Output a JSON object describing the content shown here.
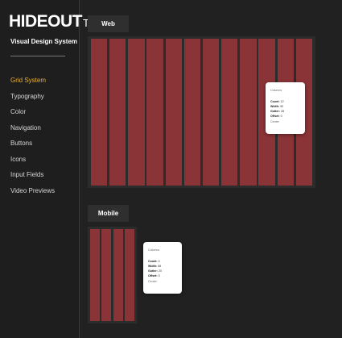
{
  "app": {
    "logo_main": "HIDEOUT",
    "logo_suffix": "TV",
    "subtitle": "Visual Design System"
  },
  "sidebar": {
    "items": [
      {
        "label": "Grid System",
        "active": true
      },
      {
        "label": "Typography",
        "active": false
      },
      {
        "label": "Color",
        "active": false
      },
      {
        "label": "Navigation",
        "active": false
      },
      {
        "label": "Buttons",
        "active": false
      },
      {
        "label": "Icons",
        "active": false
      },
      {
        "label": "Input Fields",
        "active": false
      },
      {
        "label": "Video Previews",
        "active": false
      }
    ]
  },
  "sections": {
    "web": {
      "label": "Web",
      "popup": {
        "title": "Columns",
        "count_label": "Count:",
        "count": "12",
        "width_label": "Width:",
        "width": "90",
        "gutter_label": "Gutter:",
        "gutter": "28",
        "offset_label": "Offset:",
        "offset": "0",
        "alignment": "Center"
      }
    },
    "mobile": {
      "label": "Mobile",
      "popup": {
        "title": "Columns",
        "count_label": "Count:",
        "count": "4",
        "width_label": "Width:",
        "width": "68",
        "gutter_label": "Gutter:",
        "gutter": "20",
        "offset_label": "Offset:",
        "offset": "0",
        "alignment": "Center"
      }
    }
  },
  "colors": {
    "background": "#212121",
    "column": "#8b3438",
    "accent": "#e6b13c",
    "panel": "#2c2c2c"
  }
}
